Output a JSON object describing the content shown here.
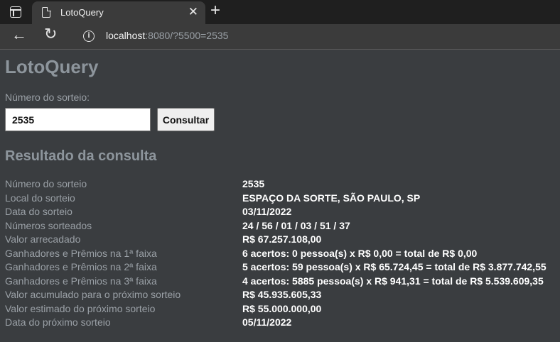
{
  "browser": {
    "tab_title": "LotoQuery",
    "url_host": "localhost",
    "url_rest": ":8080/?5500=2535"
  },
  "page": {
    "title": "LotoQuery",
    "field_label": "Número do sorteio:",
    "input_value": "2535",
    "button_label": "Consultar",
    "section_title": "Resultado da consulta"
  },
  "results": [
    {
      "label": "Número do sorteio",
      "value": "2535"
    },
    {
      "label": "Local do sorteio",
      "value": "ESPAÇO DA SORTE, SÃO PAULO, SP"
    },
    {
      "label": "Data do sorteio",
      "value": "03/11/2022"
    },
    {
      "label": "Números sorteados",
      "value": "24 / 56 / 01 / 03 / 51 / 37"
    },
    {
      "label": "Valor arrecadado",
      "value": "R$ 67.257.108,00"
    },
    {
      "label": "Ganhadores e Prêmios na 1ª faixa",
      "value": "6 acertos: 0 pessoa(s) x R$ 0,00 = total de R$ 0,00"
    },
    {
      "label": "Ganhadores e Prêmios na 2ª faixa",
      "value": "5 acertos: 59 pessoa(s) x R$ 65.724,45 = total de R$ 3.877.742,55"
    },
    {
      "label": "Ganhadores e Prêmios na 3ª faixa",
      "value": "4 acertos: 5885 pessoa(s) x R$ 941,31 = total de R$ 5.539.609,35"
    },
    {
      "label": "Valor acumulado para o próximo sorteio",
      "value": "R$ 45.935.605,33"
    },
    {
      "label": "Valor estimado do próximo sorteio",
      "value": "R$ 55.000.000,00"
    },
    {
      "label": "Data do próximo sorteio",
      "value": "05/11/2022"
    }
  ]
}
